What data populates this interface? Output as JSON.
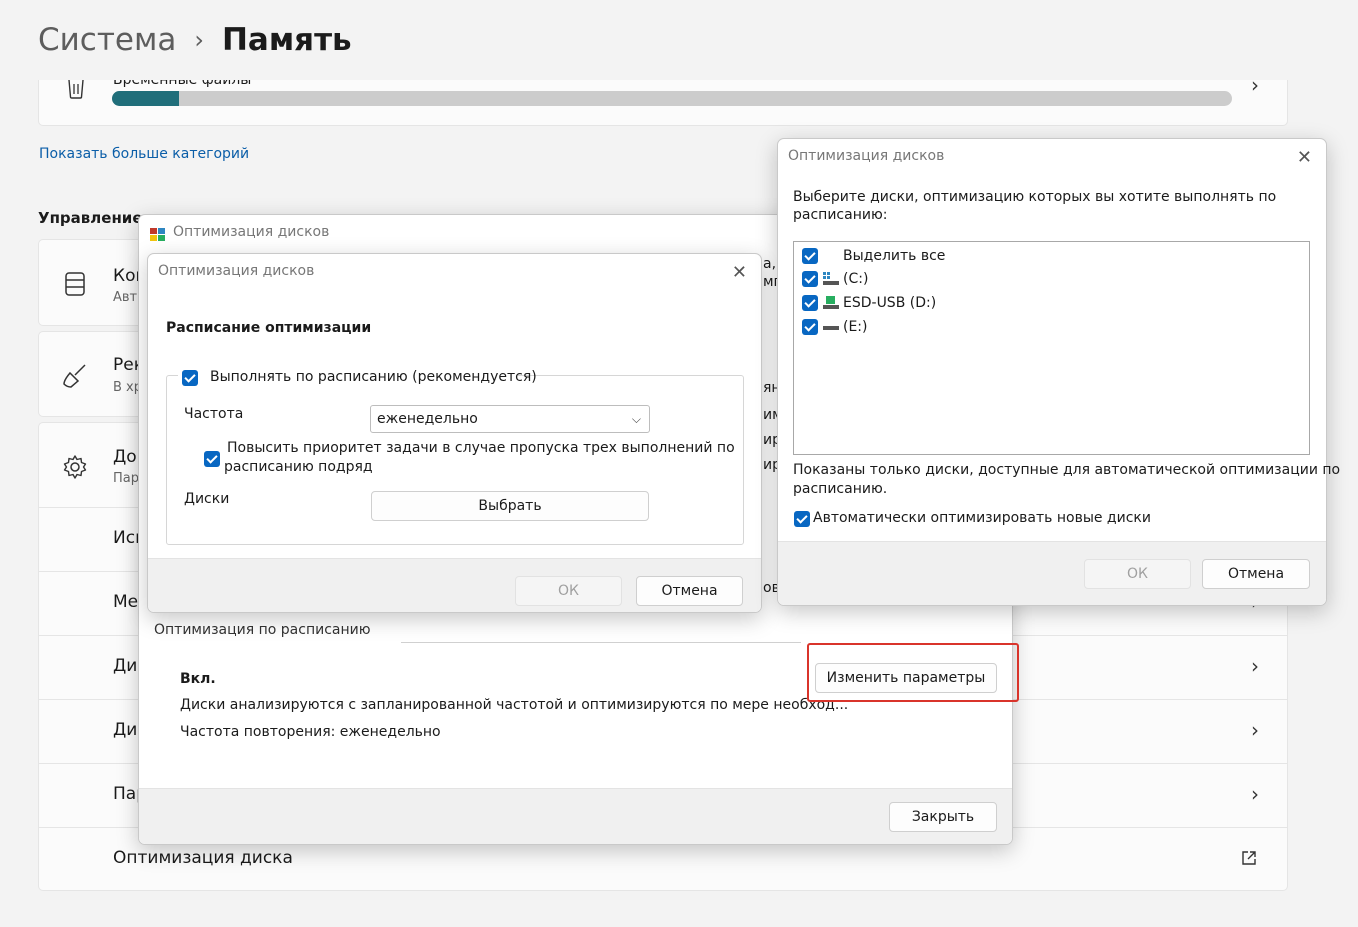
{
  "breadcrumb": {
    "parent": "Система",
    "separator": "›",
    "current": "Память"
  },
  "temp_files": {
    "label": "Временные файлы",
    "progress": 0.06
  },
  "show_more": "Показать больше категорий",
  "section": "Управление",
  "cards": [
    {
      "title": "Кон",
      "sub": "Авт"
    },
    {
      "title": "Рек",
      "sub": "В хр"
    },
    {
      "title": "Доп",
      "sub": "Пар"
    }
  ],
  "list_rows": [
    {
      "label": "Исп"
    },
    {
      "label": "Ме"
    },
    {
      "label": "Дис"
    },
    {
      "label": "Дис"
    },
    {
      "label": "Пар"
    },
    {
      "label": "Оптимизация диска"
    }
  ],
  "main_window": {
    "title": "Оптимизация дисков",
    "right_fragments": [
      "а,",
      "мг",
      "ян",
      "им",
      "ир",
      "ир",
      "ов"
    ],
    "schedule_header": "Оптимизация по расписанию",
    "status": "Вкл.",
    "description": "Диски анализируются с запланированной частотой и оптимизируются по мере необход...",
    "frequency": "Частота повторения: еженедельно",
    "change_button": "Изменить параметры",
    "close_button": "Закрыть"
  },
  "schedule_dialog": {
    "title": "Оптимизация дисков",
    "heading": "Расписание оптимизации",
    "run_on_schedule": "Выполнять по расписанию (рекомендуется)",
    "frequency_label": "Частота",
    "frequency_value": "еженедельно",
    "priority_line1": "Повысить приоритет задачи в случае пропуска трех выполнений по",
    "priority_line2": "расписанию подряд",
    "disks_label": "Диски",
    "choose_button": "Выбрать",
    "ok": "ОК",
    "cancel": "Отмена"
  },
  "disks_dialog": {
    "title": "Оптимизация дисков",
    "prompt_line1": "Выберите диски, оптимизацию которых вы хотите выполнять по",
    "prompt_line2": "расписанию:",
    "items": [
      {
        "label": "Выделить все",
        "icon": "none"
      },
      {
        "label": "(C:)",
        "icon": "windows-drive-icon"
      },
      {
        "label": "ESD-USB (D:)",
        "icon": "usb-drive-icon"
      },
      {
        "label": "(E:)",
        "icon": "drive-icon"
      }
    ],
    "note_line1": "Показаны только диски, доступные для автоматической оптимизации по",
    "note_line2": "расписанию.",
    "auto_optimize": "Автоматически оптимизировать новые диски",
    "ok": "ОК",
    "cancel": "Отмена"
  },
  "colors": {
    "accent": "#0867c2",
    "progress": "#206e7a",
    "highlight": "#d9342b",
    "link": "#0b5ea8"
  }
}
